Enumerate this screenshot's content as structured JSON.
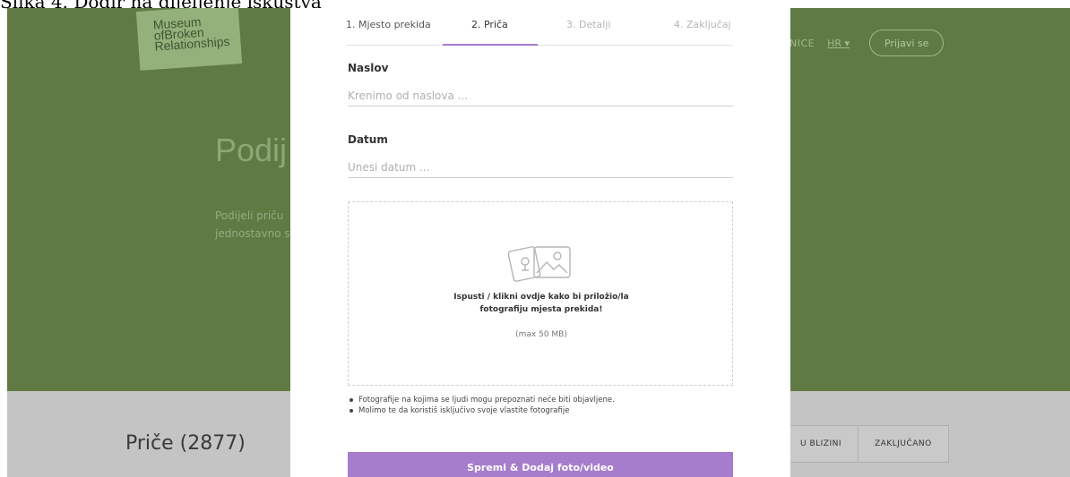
{
  "caption": "Slika 4. Dodir na dijeljenje iskustva",
  "site": {
    "logo_lines": [
      "Museum",
      "ofBroken",
      "Relationships"
    ],
    "nav_link": "NICE",
    "language": "HR ▾",
    "login_label": "Prijavi se",
    "hero_title": "Podij",
    "hero_text": "Podijeli priču jednostavno sam/a.",
    "stories_title": "Priče (2877)",
    "filter_tabs": [
      "U BLIZINI",
      "ZAKLJUČANO"
    ]
  },
  "modal": {
    "steps": [
      {
        "label": "1. Mjesto prekida",
        "state": "done"
      },
      {
        "label": "2. Priča",
        "state": "active"
      },
      {
        "label": "3. Detalji",
        "state": "pending"
      },
      {
        "label": "4. Zaključaj",
        "state": "pending"
      }
    ],
    "title_field": {
      "label": "Naslov",
      "placeholder": "Krenimo od naslova ..."
    },
    "date_field": {
      "label": "Datum",
      "placeholder": "Unesi datum ..."
    },
    "dropzone": {
      "icon": "photo-upload-icon",
      "text": "Ispusti / klikni ovdje kako bi priložio/la fotografiju mjesta prekida!",
      "limit": "(max 50 MB)"
    },
    "notes": [
      "Fotografije na kojima se ljudi mogu prepoznati neće biti objavljene.",
      "Molimo te da koristiš isključivo svoje vlastite fotografije"
    ],
    "submit_label": "Spremi & Dodaj foto/video"
  },
  "colors": {
    "hero_green": "#5f7a43",
    "accent_purple": "#a67dcc",
    "overlay_grey": "#c4c4c4"
  }
}
